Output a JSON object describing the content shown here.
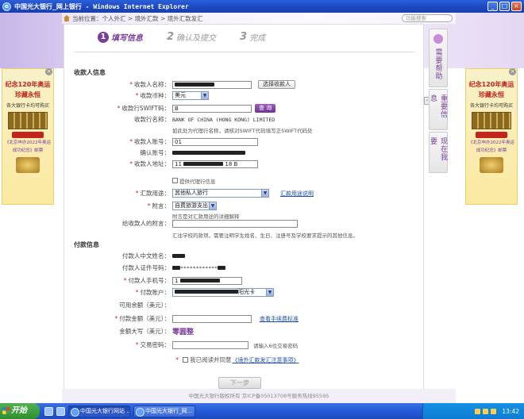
{
  "window": {
    "title": "中国光大银行_网上银行 - Windows Internet Explorer",
    "controls": [
      "_",
      "□",
      "×"
    ]
  },
  "breadcrumb": {
    "prefix": "当前位置：",
    "items": [
      "个人外汇",
      "境外汇款",
      "境外汇款发汇"
    ],
    "search_placeholder": "功能搜索"
  },
  "steps": [
    {
      "num": "1",
      "label": "填写信息",
      "active": true
    },
    {
      "num": "2",
      "label": "确认及提交",
      "active": false
    },
    {
      "num": "3",
      "label": "完成",
      "active": false
    }
  ],
  "payee": {
    "section_title": "收款人信息",
    "name_label": "收款人名称：",
    "select_payee_button": "选择收款人",
    "currency_label": "收款币种：",
    "currency_value": "美元",
    "swift_label": "收款行SWIFT码：",
    "swift_value": "B",
    "query_button": "查 询",
    "bank_name_label": "收款行名称：",
    "bank_name_value": "BANK OF CHINA (HONG KONG) LIMITED",
    "swift_note": "如此处为代理行名称，请核对SWIFT代码填写正SWIFT代码处",
    "account_label": "收款人账号：",
    "account_value": "01",
    "confirm_account_label": "确认账号：",
    "address_label": "收款人地址：",
    "address_value": "11",
    "address_suffix": "18 B",
    "agent_bank_checkbox": "提供代理行信息",
    "purpose_label": "汇款用途：",
    "purpose_value": "其他私人旅行",
    "purpose_link": "汇款用途说明",
    "postscript_label": "附言：",
    "postscript_value": "自费旅游支出",
    "postscript_note": "附言是对汇款用途的详细解释",
    "message_label": "给收款人的附言：",
    "message_note": "汇往学校的款项，需要注明学生姓名、生日、注册号及学校要求提示的其他信息。"
  },
  "payer": {
    "section_title": "付款信息",
    "name_label": "付款人中文姓名：",
    "id_label": "付款人证件号码：",
    "id_value": "************",
    "phone_label": "付款人手机号：",
    "phone_value": "1",
    "account_label": "付款账户：",
    "account_value": "阳光卡",
    "balance_label": "可用余额（美元）：",
    "amount_label": "付款金额（美元）：",
    "fee_link": "查看手续费标准",
    "amount_words_label": "金额大写（美元）：",
    "amount_words_value": "零圆整",
    "password_label": "交易密码：",
    "password_note": "请输入6位交易密码",
    "agree_text": "我已阅读并同意",
    "agree_link": "《境外汇款发汇注意事项》",
    "next_button": "下一步"
  },
  "footer": "中国光大银行版权所有 京ICP备05013708号服务热线95595",
  "sidebar": {
    "items": [
      "需要帮助",
      "重要信息",
      "现在我要"
    ]
  },
  "ads": {
    "title": "纪念120年奥运",
    "subtitle": "珍藏永恒",
    "line1": "各大银行卡均可购买",
    "line2": "《北京申办2022年奥运",
    "line3": "成功纪念》邮票",
    "line4": "阿金币珍藏版"
  },
  "taskbar": {
    "start": "开始",
    "tasks": [
      "中国光大银行网站 ...",
      "中国光大银行_网..."
    ],
    "clock": "13:42"
  }
}
